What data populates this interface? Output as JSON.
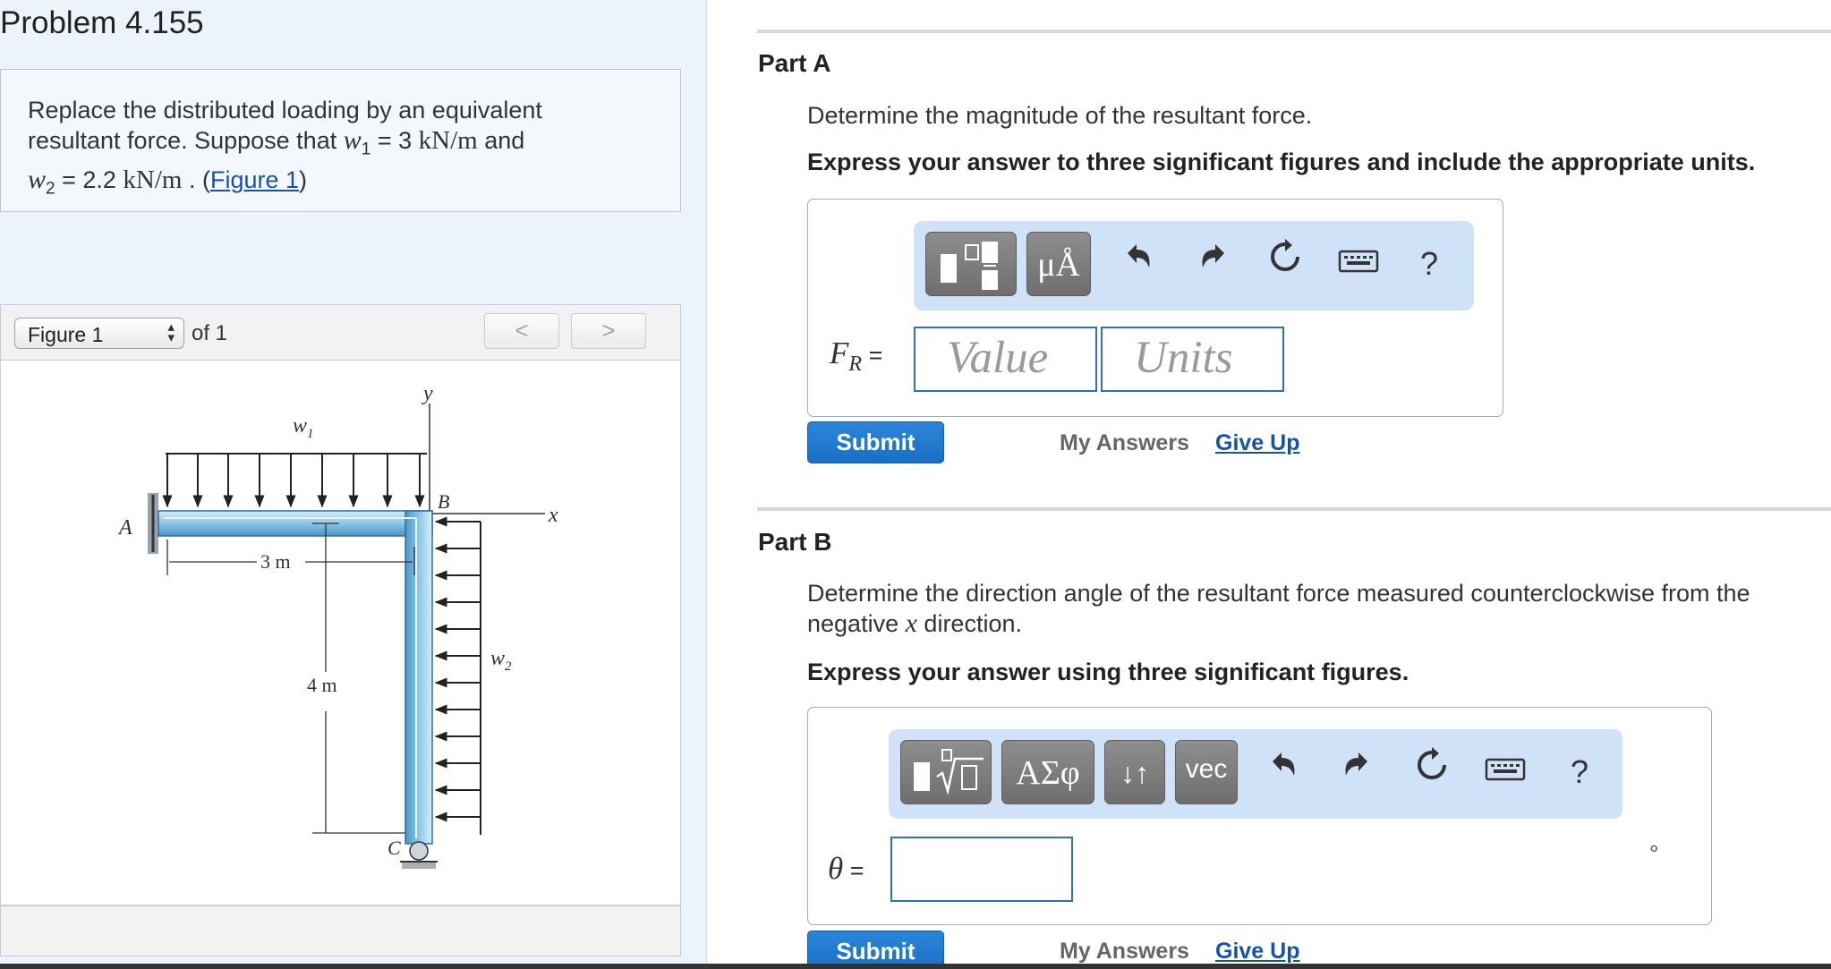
{
  "problem": {
    "title": "Problem 4.155",
    "text_1": "Replace the distributed loading by an equivalent",
    "text_2": "resultant force. Suppose that",
    "w1_symbol": "w",
    "w1_sub": "1",
    "w1_eq": " = 3 ",
    "w1_unit": "kN/m",
    "and": " and",
    "w2_symbol": "w",
    "w2_sub": "2",
    "w2_eq": " = 2.2 ",
    "w2_unit": "kN/m",
    "period": " . (",
    "figure_link": "Figure 1",
    "close_paren": ")"
  },
  "figure": {
    "selected": "Figure 1",
    "of_label": "of 1",
    "prev": "<",
    "next": ">",
    "labels": {
      "w1": "w",
      "w1_sub": "1",
      "w2": "w",
      "w2_sub": "2",
      "y": "y",
      "x": "x",
      "A": "A",
      "B": "B",
      "C": "C",
      "len_3": "3 m",
      "len_4": "4 m"
    }
  },
  "partA": {
    "title": "Part A",
    "prompt": "Determine the magnitude of the resultant force.",
    "instruction": "Express your answer to three significant figures and include the appropriate units.",
    "toolbar": {
      "units_btn": "μÅ",
      "help": "?"
    },
    "label_main": "F",
    "label_sub": "R",
    "label_eq": " =",
    "value_placeholder": "Value",
    "units_placeholder": "Units",
    "submit": "Submit",
    "my_answers": "My Answers",
    "give_up": "Give Up"
  },
  "partB": {
    "title": "Part B",
    "prompt_1": "Determine the direction angle of the resultant force measured counterclockwise from the",
    "prompt_2a": "negative ",
    "prompt_var": "x",
    "prompt_2b": " direction.",
    "instruction": "Express your answer using three significant figures.",
    "toolbar": {
      "greek_btn": "ΑΣφ",
      "arrows_btn": "↓↑",
      "vec_btn": "vec",
      "help": "?"
    },
    "label_main": "θ",
    "label_eq": " =",
    "degree": "°",
    "submit": "Submit",
    "my_answers": "My Answers",
    "give_up": "Give Up"
  },
  "colors": {
    "accent": "#1a6fc4",
    "toolbar_bg": "#cfe2f8",
    "beam": "#8cc6e6",
    "panel_bg": "#edf3fb"
  }
}
